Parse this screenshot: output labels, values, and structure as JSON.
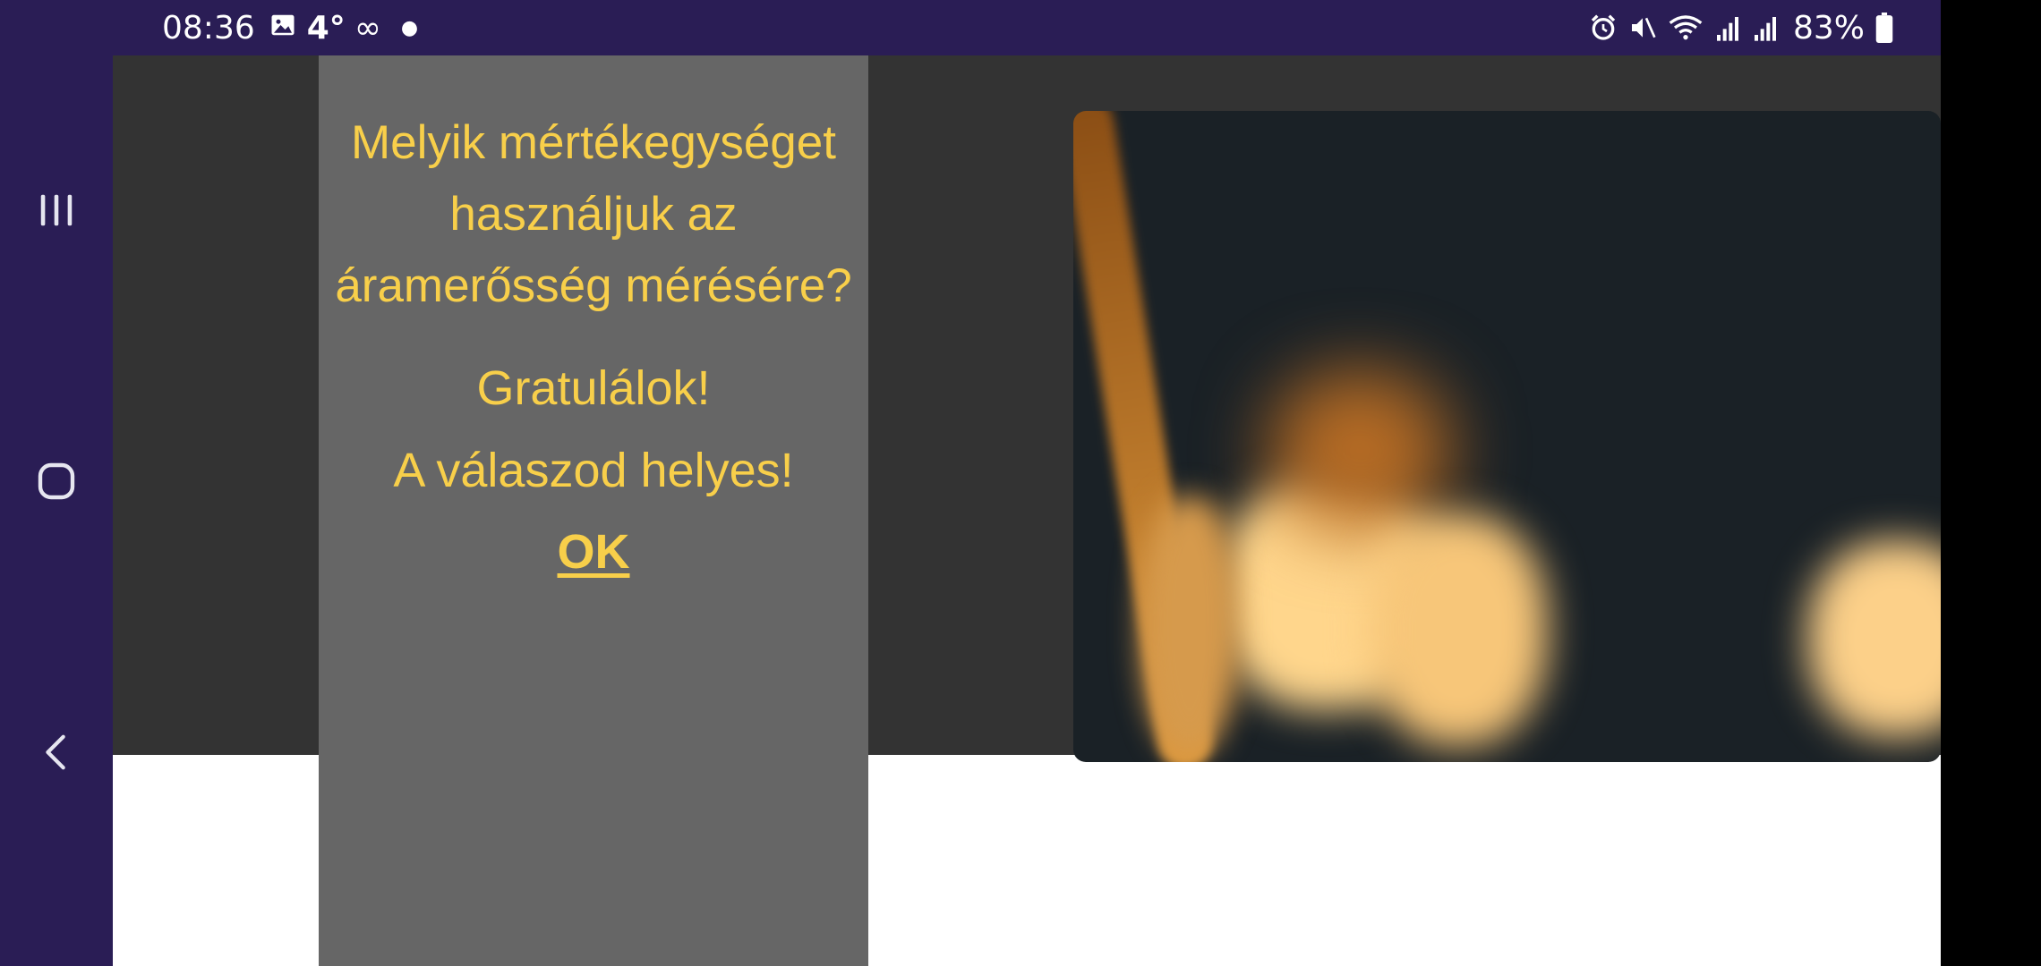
{
  "status_bar": {
    "time": "08:36",
    "temperature": "4°",
    "battery": "83%",
    "icons": [
      "gallery-icon",
      "infinity-icon",
      "alarm-icon",
      "mute-icon",
      "wifi-icon",
      "signal-icon",
      "battery-icon"
    ]
  },
  "quiz": {
    "question": "Melyik mértékegységet használjuk az áramerősség mérésére?",
    "feedback_title": "Gratulálok!",
    "feedback_message": "A válaszod helyes!",
    "ok_label": "OK"
  },
  "nav_bar": {
    "buttons": [
      "recent-apps-button",
      "home-button",
      "back-button"
    ]
  },
  "colors": {
    "system_bar": "#2a1d55",
    "panel": "#666666",
    "dark_background": "#333333",
    "accent_text": "#f8cf4a"
  }
}
